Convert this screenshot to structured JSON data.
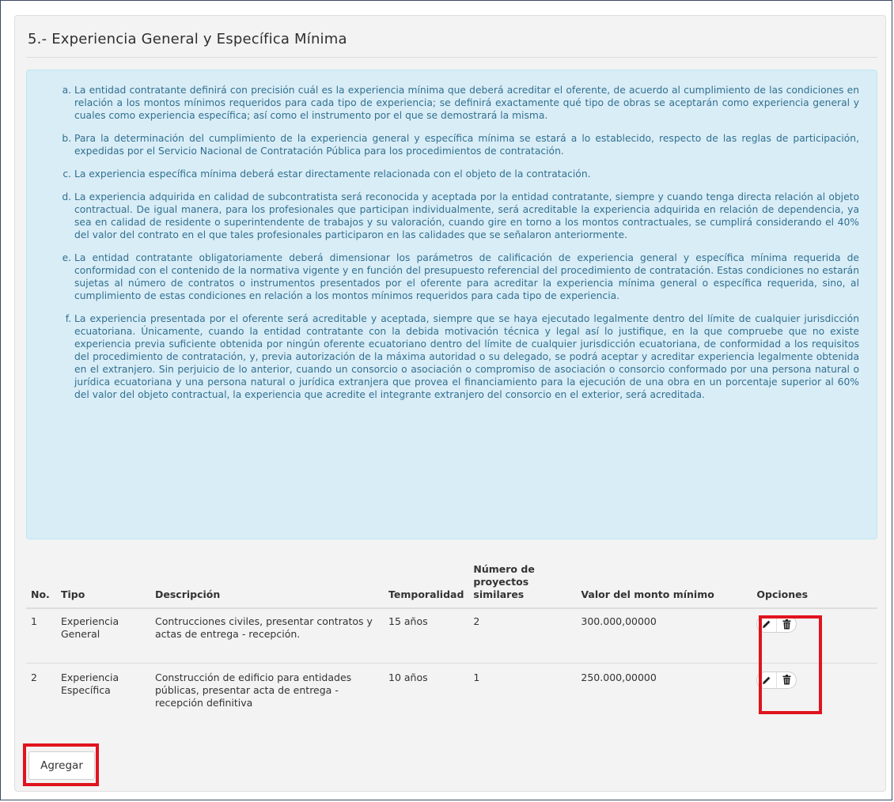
{
  "section": {
    "title": "5.- Experiencia General y Específica Mínima"
  },
  "info": {
    "items": [
      "La entidad contratante definirá con precisión cuál es la experiencia mínima que deberá acreditar el oferente, de acuerdo al cumplimiento de las condiciones en relación a los montos mínimos requeridos para cada tipo de experiencia; se definirá exactamente qué tipo de obras se aceptarán como experiencia general y cuales como experiencia específica; así como el instrumento por el que se demostrará la misma.",
      "Para la determinación del cumplimiento de la experiencia general y específica mínima se estará a lo establecido, respecto de las reglas de participación, expedidas por el Servicio Nacional de Contratación Pública para los procedimientos de contratación.",
      "La experiencia específica mínima deberá estar directamente relacionada con el objeto de la contratación.",
      "La experiencia adquirida en calidad de subcontratista será reconocida y aceptada por la entidad contratante, siempre y cuando tenga directa relación al objeto contractual. De igual manera, para los profesionales que participan individualmente, será acreditable la experiencia adquirida en relación de dependencia, ya sea en calidad de residente o superintendente de trabajos y su valoración, cuando gire en torno a los montos contractuales, se cumplirá considerando el 40% del valor del contrato en el que tales profesionales participaron en las calidades que se señalaron anteriormente.",
      "La entidad contratante obligatoriamente deberá dimensionar los parámetros de calificación de experiencia general y específica mínima requerida de conformidad con el contenido de la normativa vigente y en función del presupuesto referencial del procedimiento de contratación. Estas condiciones no estarán sujetas al número de contratos o instrumentos presentados por el oferente para acreditar la experiencia mínima general o específica requerida, sino, al cumplimiento de estas condiciones en relación a los montos mínimos requeridos para cada tipo de experiencia.",
      "La experiencia presentada por el oferente será acreditable y aceptada, siempre que se haya ejecutado legalmente dentro del límite de cualquier jurisdicción ecuatoriana. Únicamente, cuando la entidad contratante con la debida motivación técnica y legal así lo justifique, en la que compruebe que no existe experiencia previa suficiente obtenida por ningún oferente ecuatoriano dentro del límite de cualquier jurisdicción ecuatoriana, de conformidad a los requisitos del procedimiento de contratación, y, previa autorización de la máxima autoridad o su delegado, se podrá aceptar y acreditar experiencia legalmente obtenida en el extranjero. Sin perjuicio de lo anterior, cuando un consorcio o asociación o compromiso de asociación o consorcio conformado por una persona natural o jurídica ecuatoriana y una persona natural o jurídica extranjera que provea el financiamiento para la ejecución de una obra en un porcentaje superior al 60% del valor del objeto contractual, la experiencia que acredite el integrante extranjero del consorcio en el exterior, será acreditada."
    ]
  },
  "table": {
    "headers": {
      "no": "No.",
      "tipo": "Tipo",
      "descripcion": "Descripción",
      "temporalidad": "Temporalidad",
      "numero": "Número de proyectos similares",
      "valor": "Valor del monto mínimo",
      "opciones": "Opciones"
    },
    "rows": [
      {
        "no": "1",
        "tipo": "Experiencia General",
        "descripcion": "Contrucciones civiles, presentar contratos y actas de entrega - recepción.",
        "temporalidad": "15 años",
        "numero": "2",
        "valor": "300.000,00000"
      },
      {
        "no": "2",
        "tipo": "Experiencia Específica",
        "descripcion": "Construcción de edificio para entidades públicas, presentar acta de entrega - recepción definitiva",
        "temporalidad": "10 años",
        "numero": "1",
        "valor": "250.000,00000"
      }
    ]
  },
  "actions": {
    "add_label": "Agregar"
  },
  "icons": {
    "edit": "pencil-icon",
    "delete": "trash-icon"
  },
  "colors": {
    "info_bg": "#d9edf7",
    "info_text": "#31708f",
    "highlight": "#e0141e"
  }
}
